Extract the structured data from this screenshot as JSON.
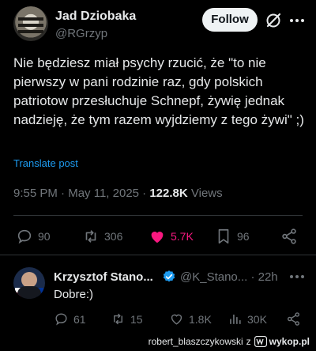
{
  "tweet": {
    "author_name": "Jad Dziobaka",
    "author_handle": "@RGrzyp",
    "follow_label": "Follow",
    "text": "Nie będziesz miał psychy rzucić, że \"to nie pierwszy w pani rodzinie raz, gdy polskich patriotow przesłuchuje Schnepf, żywię jednak nadzieję, że tym razem wyjdziemy z tego żywi\" ;)",
    "translate_label": "Translate post",
    "time": "9:55 PM",
    "date": "May 11, 2025",
    "views_count": "122.8K",
    "views_label": "Views",
    "stats": {
      "replies": "90",
      "reposts": "306",
      "likes": "5.7K",
      "bookmarks": "96"
    }
  },
  "reply": {
    "author_name": "Krzysztof Stano...",
    "author_handle": "@K_Stano...",
    "time": "22h",
    "text": "Dobre:)",
    "stats": {
      "replies": "61",
      "reposts": "15",
      "likes": "1.8K",
      "views": "30K"
    }
  },
  "watermark": {
    "user": "robert_blaszczykowski",
    "letter": "z",
    "site": "wykop.pl"
  },
  "colors": {
    "background": "#000000",
    "text": "#e7e9ea",
    "secondary": "#71767b",
    "link": "#1d9bf0",
    "like": "#f91880",
    "verified": "#1d9bf0"
  }
}
